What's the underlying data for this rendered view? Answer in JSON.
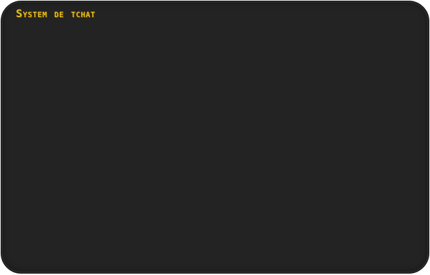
{
  "panel": {
    "title": "System de tchat"
  },
  "colors": {
    "panel_background": "#232323",
    "title": "#e8bd1e"
  }
}
